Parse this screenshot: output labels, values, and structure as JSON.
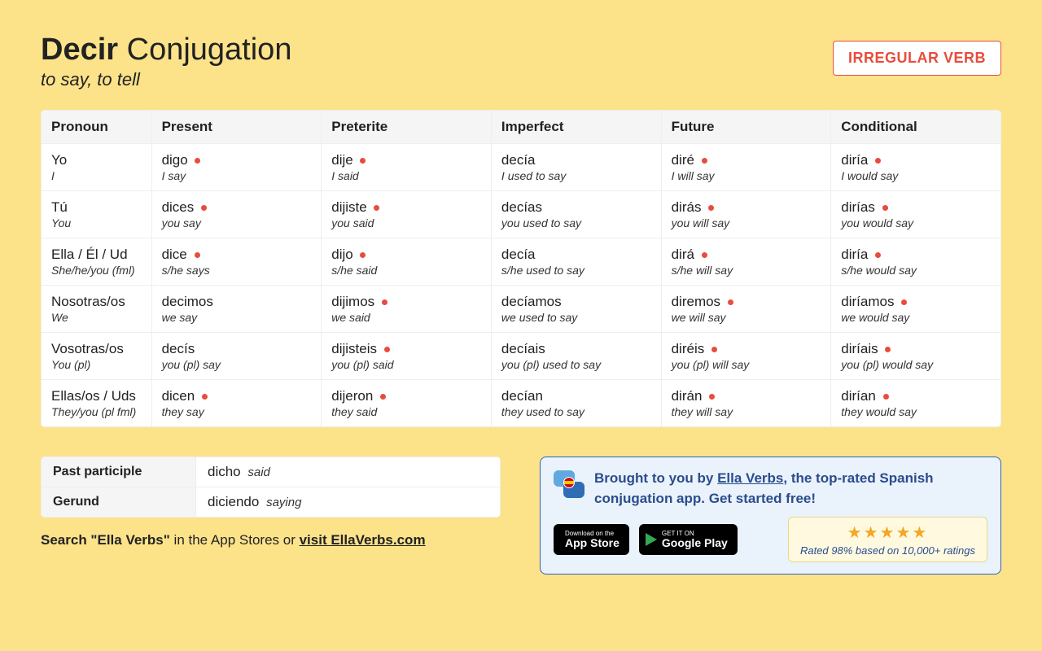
{
  "header": {
    "verb": "Decir",
    "conj_word": "Conjugation",
    "subtitle": "to say, to tell",
    "badge": "IRREGULAR VERB"
  },
  "table": {
    "headers": [
      "Pronoun",
      "Present",
      "Preterite",
      "Imperfect",
      "Future",
      "Conditional"
    ],
    "rows": [
      {
        "pronoun": {
          "main": "Yo",
          "sub": "I"
        },
        "cells": [
          {
            "main": "digo",
            "sub": "I say",
            "irr": true
          },
          {
            "main": "dije",
            "sub": "I said",
            "irr": true
          },
          {
            "main": "decía",
            "sub": "I used to say",
            "irr": false
          },
          {
            "main": "diré",
            "sub": "I will say",
            "irr": true
          },
          {
            "main": "diría",
            "sub": "I would say",
            "irr": true
          }
        ]
      },
      {
        "pronoun": {
          "main": "Tú",
          "sub": "You"
        },
        "cells": [
          {
            "main": "dices",
            "sub": "you say",
            "irr": true
          },
          {
            "main": "dijiste",
            "sub": "you said",
            "irr": true
          },
          {
            "main": "decías",
            "sub": "you used to say",
            "irr": false
          },
          {
            "main": "dirás",
            "sub": "you will say",
            "irr": true
          },
          {
            "main": "dirías",
            "sub": "you would say",
            "irr": true
          }
        ]
      },
      {
        "pronoun": {
          "main": "Ella / Él / Ud",
          "sub": "She/he/you (fml)"
        },
        "cells": [
          {
            "main": "dice",
            "sub": "s/he says",
            "irr": true
          },
          {
            "main": "dijo",
            "sub": "s/he said",
            "irr": true
          },
          {
            "main": "decía",
            "sub": "s/he used to say",
            "irr": false
          },
          {
            "main": "dirá",
            "sub": "s/he will say",
            "irr": true
          },
          {
            "main": "diría",
            "sub": "s/he would say",
            "irr": true
          }
        ]
      },
      {
        "pronoun": {
          "main": "Nosotras/os",
          "sub": "We"
        },
        "cells": [
          {
            "main": "decimos",
            "sub": "we say",
            "irr": false
          },
          {
            "main": "dijimos",
            "sub": "we said",
            "irr": true
          },
          {
            "main": "decíamos",
            "sub": "we used to say",
            "irr": false
          },
          {
            "main": "diremos",
            "sub": "we will say",
            "irr": true
          },
          {
            "main": "diríamos",
            "sub": "we would say",
            "irr": true
          }
        ]
      },
      {
        "pronoun": {
          "main": "Vosotras/os",
          "sub": "You (pl)"
        },
        "cells": [
          {
            "main": "decís",
            "sub": "you (pl) say",
            "irr": false
          },
          {
            "main": "dijisteis",
            "sub": "you (pl) said",
            "irr": true
          },
          {
            "main": "decíais",
            "sub": "you (pl) used to say",
            "irr": false
          },
          {
            "main": "diréis",
            "sub": "you (pl) will say",
            "irr": true
          },
          {
            "main": "diríais",
            "sub": "you (pl) would say",
            "irr": true
          }
        ]
      },
      {
        "pronoun": {
          "main": "Ellas/os / Uds",
          "sub": "They/you (pl fml)"
        },
        "cells": [
          {
            "main": "dicen",
            "sub": "they say",
            "irr": true
          },
          {
            "main": "dijeron",
            "sub": "they said",
            "irr": true
          },
          {
            "main": "decían",
            "sub": "they used to say",
            "irr": false
          },
          {
            "main": "dirán",
            "sub": "they will say",
            "irr": true
          },
          {
            "main": "dirían",
            "sub": "they would say",
            "irr": true
          }
        ]
      }
    ]
  },
  "participles": {
    "past_label": "Past participle",
    "past_value": "dicho",
    "past_gloss": "said",
    "gerund_label": "Gerund",
    "gerund_value": "diciendo",
    "gerund_gloss": "saying"
  },
  "search_line": {
    "bold": "Search \"Ella Verbs\"",
    "rest": " in the App Stores or ",
    "link": "visit EllaVerbs.com"
  },
  "promo": {
    "lead": "Brought to you by ",
    "link": "Ella Verbs",
    "tail": ", the top-rated Spanish conjugation app. Get started free!",
    "appstore_small": "Download on the",
    "appstore_big": "App Store",
    "play_small": "GET IT ON",
    "play_big": "Google Play",
    "stars": "★★★★★",
    "rating": "Rated 98% based on 10,000+ ratings"
  }
}
